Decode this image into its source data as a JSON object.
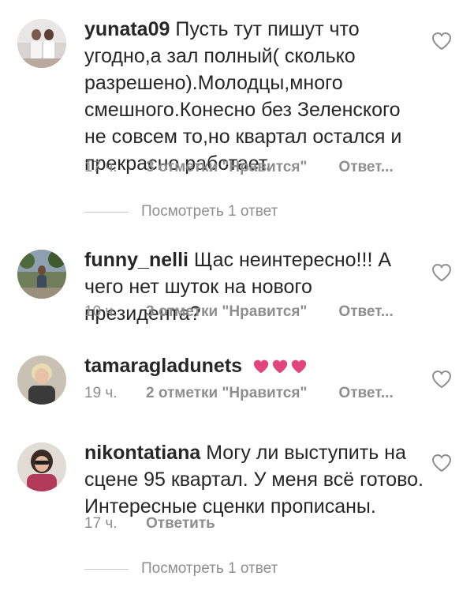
{
  "comments": [
    {
      "username": "yunata09",
      "text": "Пусть тут пишут что угодно,а зал полный( сколько разрешено).Молодцы,много смешного.Конесно без Зеленского не совсем то,но квартал остался и прекрасно работает.",
      "time": "17 ч.",
      "likes": "3 отметки \"Нравится\"",
      "reply": "Ответ...",
      "view_replies": "Посмотреть 1 ответ"
    },
    {
      "username": "funny_nelli",
      "text": "Щас неинтересно!!! А чего нет шуток на нового президента?",
      "time": "10 ч.",
      "likes": "3 отметки \"Нравится\"",
      "reply": "Ответ..."
    },
    {
      "username": "tamaragladunets",
      "text": "",
      "emoji": "heart-emoji x3",
      "time": "19 ч.",
      "likes": "2 отметки \"Нравится\"",
      "reply": "Ответ..."
    },
    {
      "username": "nikontatiana",
      "text": "Могу ли выступить на сцене 95 квартал. У меня всё готово. Интересные сценки прописаны.",
      "time": "17 ч.",
      "reply": "Ответить",
      "view_replies": "Посмотреть 1 ответ"
    }
  ],
  "colors": {
    "text": "#262626",
    "secondary": "#8e8e8e",
    "heart_emoji": "#e0457b"
  },
  "icons": {
    "like": "heart-outline-icon"
  }
}
